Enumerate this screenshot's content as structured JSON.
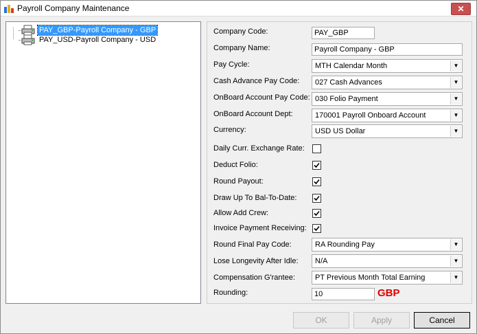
{
  "window": {
    "title": "Payroll Company Maintenance",
    "close_glyph": "✕",
    "icon": "payroll-app-icon"
  },
  "tree": {
    "items": [
      {
        "label": "PAY_GBP-Payroll Company - GBP",
        "selected": true
      },
      {
        "label": "PAY_USD-Payroll Company - USD",
        "selected": false
      }
    ]
  },
  "form": {
    "company_code": {
      "label": "Company Code:",
      "value": "PAY_GBP"
    },
    "company_name": {
      "label": "Company Name:",
      "value": "Payroll Company - GBP"
    },
    "pay_cycle": {
      "label": "Pay Cycle:",
      "value": "MTH Calendar Month"
    },
    "cash_advance": {
      "label": "Cash Advance Pay Code:",
      "value": "027 Cash Advances"
    },
    "onboard_pay_code": {
      "label": "OnBoard Account Pay Code:",
      "value": "030 Folio Payment"
    },
    "onboard_dept": {
      "label": "OnBoard Account Dept:",
      "value": "170001 Payroll Onboard Account"
    },
    "currency": {
      "label": "Currency:",
      "value": "USD US Dollar"
    },
    "daily_exchange": {
      "label": "Daily Curr. Exchange Rate:",
      "checked": false
    },
    "deduct_folio": {
      "label": "Deduct Folio:",
      "checked": true
    },
    "round_payout": {
      "label": "Round Payout:",
      "checked": true
    },
    "draw_up": {
      "label": "Draw Up To Bal-To-Date:",
      "checked": true
    },
    "allow_add_crew": {
      "label": "Allow Add Crew:",
      "checked": true
    },
    "invoice_payment": {
      "label": "Invoice Payment Receiving:",
      "checked": true
    },
    "round_final": {
      "label": "Round Final Pay Code:",
      "value": "RA Rounding Pay"
    },
    "lose_longevity": {
      "label": "Lose Longevity After Idle:",
      "value": "N/A"
    },
    "compensation": {
      "label": "Compensation G'rantee:",
      "value": "PT Previous Month Total Earning"
    },
    "rounding": {
      "label": "Rounding:",
      "value": "10",
      "currency_tag": "GBP"
    }
  },
  "buttons": {
    "ok": "OK",
    "apply": "Apply",
    "cancel": "Cancel"
  },
  "colors": {
    "selection": "#3399ff",
    "currency_tag": "#e00000",
    "close": "#c75050"
  }
}
